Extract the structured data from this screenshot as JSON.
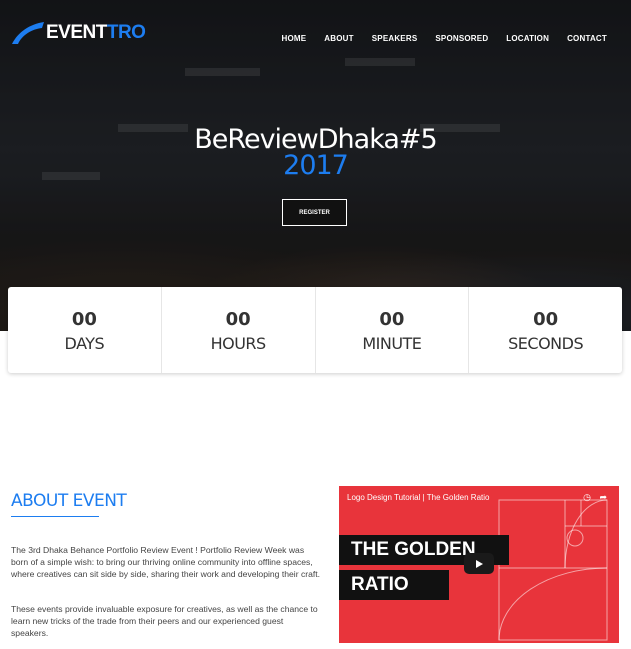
{
  "brand": {
    "name_part1": "EVENT",
    "name_part2": "TRO",
    "accent": "#1d7df0"
  },
  "nav": [
    "HOME",
    "ABOUT",
    "SPEAKERS",
    "SPONSORED",
    "LOCATION",
    "CONTACT"
  ],
  "hero": {
    "title": "BeReviewDhaka#5",
    "year": "2017",
    "register_label": "REGISTER"
  },
  "countdown": [
    {
      "value": "00",
      "label": "DAYS"
    },
    {
      "value": "00",
      "label": "HOURS"
    },
    {
      "value": "00",
      "label": "MINUTE"
    },
    {
      "value": "00",
      "label": "SECONDS"
    }
  ],
  "about": {
    "title": "ABOUT EVENT",
    "p1": "The 3rd Dhaka Behance Portfolio Review Event ! Portfolio Review Week was born of a simple wish: to bring our thriving online community into offline spaces, where creatives can sit side by side, sharing their work and developing their craft.",
    "p2": "These events provide invaluable exposure for creatives, as well as the chance to learn new tricks of the trade from their peers and our experienced guest speakers."
  },
  "video": {
    "title": "Logo Design Tutorial | The Golden Ratio",
    "line1": "THE GOLDEN",
    "line2": "RATIO",
    "bg_color": "#e8343b"
  }
}
